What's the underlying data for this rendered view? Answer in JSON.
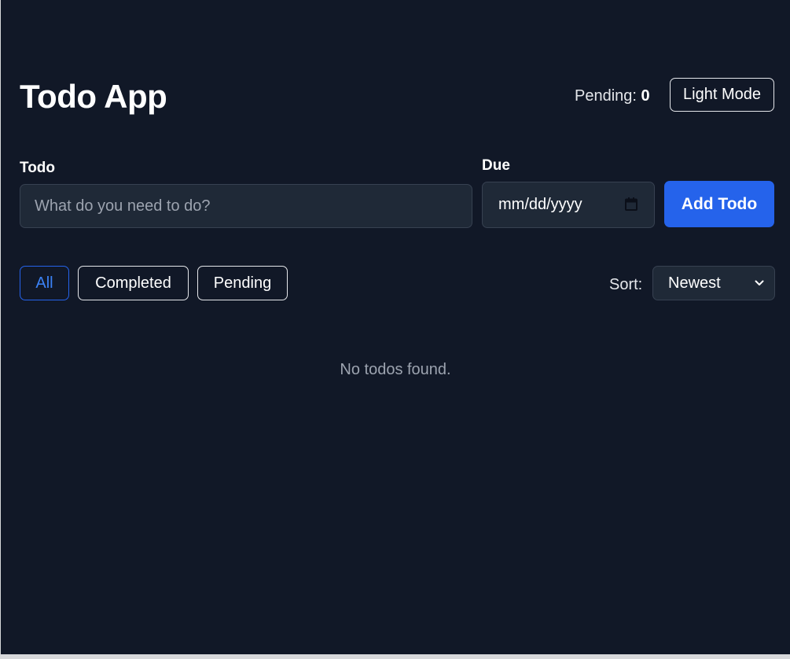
{
  "header": {
    "title": "Todo App",
    "pending_label": "Pending:",
    "pending_count": "0",
    "theme_toggle_label": "Light Mode"
  },
  "form": {
    "todo_label": "Todo",
    "todo_placeholder": "What do you need to do?",
    "todo_value": "",
    "due_label": "Due",
    "due_placeholder": "mm/dd/yyyy",
    "add_button_label": "Add Todo"
  },
  "filters": {
    "items": [
      {
        "label": "All",
        "active": true
      },
      {
        "label": "Completed",
        "active": false
      },
      {
        "label": "Pending",
        "active": false
      }
    ]
  },
  "sort": {
    "label": "Sort:",
    "selected": "Newest"
  },
  "list": {
    "empty_message": "No todos found."
  },
  "icons": {
    "date_picker": "calendar-icon",
    "sort_dropdown": "chevron-down-icon"
  },
  "colors": {
    "background": "#111827",
    "surface": "#1f2937",
    "border": "#374151",
    "accent": "#2563eb",
    "accent_text": "#3b82f6",
    "muted_text": "#9ca3af"
  }
}
